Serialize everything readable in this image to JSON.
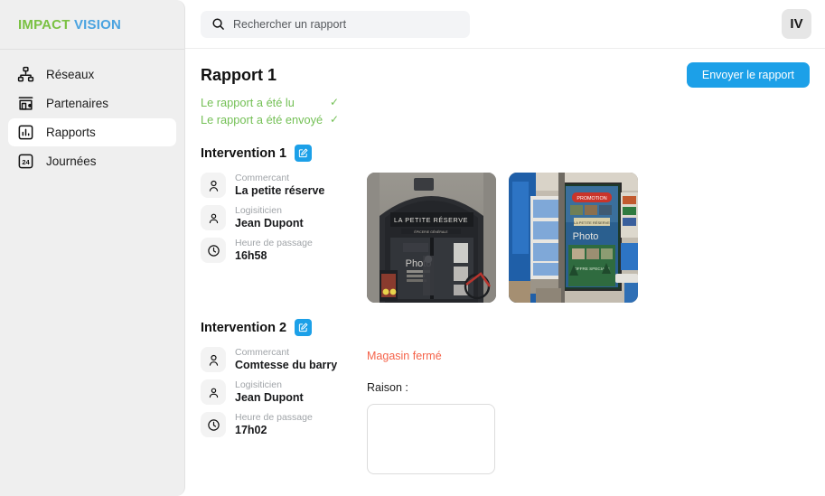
{
  "brand": {
    "name_primary": "IMPACT",
    "name_secondary": "VISION",
    "color_primary": "#7ac143",
    "color_secondary": "#4aa3e0"
  },
  "sidebar": {
    "items": [
      {
        "label": "Réseaux",
        "icon": "network-icon",
        "active": false
      },
      {
        "label": "Partenaires",
        "icon": "store-pin-icon",
        "active": false
      },
      {
        "label": "Rapports",
        "icon": "bar-chart-icon",
        "active": true
      },
      {
        "label": "Journées",
        "icon": "calendar-24-icon",
        "active": false
      }
    ]
  },
  "topbar": {
    "search": {
      "placeholder": "Rechercher un rapport",
      "value": "",
      "icon": "search-icon"
    },
    "avatar": {
      "initials": "IV"
    }
  },
  "report": {
    "title": "Rapport 1",
    "send_button": "Envoyer le rapport",
    "accent_color": "#1ca0e8",
    "status": [
      {
        "text": "Le rapport a été lu",
        "check": "✓",
        "color": "#74c056"
      },
      {
        "text": "Le rapport a été envoyé",
        "check": "✓",
        "color": "#74c056"
      }
    ]
  },
  "interventions": [
    {
      "title": "Intervention 1",
      "edit_icon": "edit-pencil-icon",
      "details": [
        {
          "icon": "person-circle-icon",
          "label": "Commercant",
          "value": "La petite réserve"
        },
        {
          "icon": "person-icon",
          "label": "Logisiticien",
          "value": "Jean Dupont"
        },
        {
          "icon": "clock-icon",
          "label": "Heure de passage",
          "value": "16h58"
        }
      ],
      "photos": [
        {
          "alt": "Devanture La Petite Réserve",
          "sign_text": "LA PETITE RÉSERVE",
          "overlay_text": "Photo"
        },
        {
          "alt": "Intérieur magasin avec affiche",
          "sign_text": "",
          "overlay_text": "Photo"
        }
      ],
      "closed": null
    },
    {
      "title": "Intervention 2",
      "edit_icon": "edit-pencil-icon",
      "details": [
        {
          "icon": "person-circle-icon",
          "label": "Commercant",
          "value": "Comtesse du barry"
        },
        {
          "icon": "person-icon",
          "label": "Logisiticien",
          "value": "Jean Dupont"
        },
        {
          "icon": "clock-icon",
          "label": "Heure de passage",
          "value": "17h02"
        }
      ],
      "photos": [],
      "closed": {
        "status_text": "Magasin fermé",
        "status_color": "#f5634a",
        "reason_label": "Raison :",
        "reason_value": "",
        "reason_placeholder": ""
      }
    }
  ]
}
